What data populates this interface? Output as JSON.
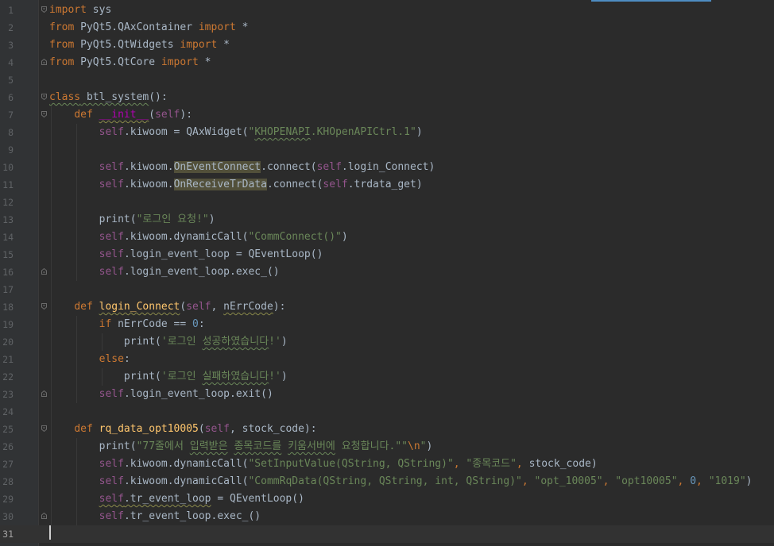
{
  "editor": {
    "language": "python",
    "current_line": 31,
    "lines": [
      {
        "n": "1",
        "fold": "top",
        "tokens": [
          [
            "kw",
            "import"
          ],
          [
            "p",
            " sys"
          ]
        ]
      },
      {
        "n": "2",
        "fold": "",
        "tokens": [
          [
            "kw",
            "from"
          ],
          [
            "p",
            " PyQt5.QAxContainer "
          ],
          [
            "kw",
            "import"
          ],
          [
            "p",
            " *"
          ]
        ]
      },
      {
        "n": "3",
        "fold": "",
        "tokens": [
          [
            "kw",
            "from"
          ],
          [
            "p",
            " PyQt5.QtWidgets "
          ],
          [
            "kw",
            "import"
          ],
          [
            "p",
            " *"
          ]
        ]
      },
      {
        "n": "4",
        "fold": "bottom",
        "tokens": [
          [
            "kw",
            "from"
          ],
          [
            "p",
            " PyQt5.QtCore "
          ],
          [
            "kw",
            "import"
          ],
          [
            "p",
            " *"
          ]
        ]
      },
      {
        "n": "5",
        "fold": "",
        "tokens": []
      },
      {
        "n": "6",
        "fold": "top",
        "tokens": [
          [
            "kw wavy",
            "class"
          ],
          [
            "p wavy",
            " btl_system"
          ],
          [
            "p",
            "():"
          ]
        ]
      },
      {
        "n": "7",
        "fold": "top",
        "tokens": [
          [
            "p",
            "    "
          ],
          [
            "kw",
            "def "
          ],
          [
            "magic wavy-y",
            "__init__"
          ],
          [
            "p",
            "("
          ],
          [
            "self",
            "self"
          ],
          [
            "p",
            "):"
          ]
        ]
      },
      {
        "n": "8",
        "fold": "",
        "tokens": [
          [
            "p",
            "        "
          ],
          [
            "self",
            "self"
          ],
          [
            "p",
            ".kiwoom = QAxWidget("
          ],
          [
            "str",
            "\""
          ],
          [
            "str wavy",
            "KHOPENAPI"
          ],
          [
            "str",
            ".KHOpenAPICtrl.1\""
          ],
          [
            "p",
            ")"
          ]
        ]
      },
      {
        "n": "9",
        "fold": "",
        "tokens": []
      },
      {
        "n": "10",
        "fold": "",
        "tokens": [
          [
            "p",
            "        "
          ],
          [
            "self",
            "self"
          ],
          [
            "p",
            ".kiwoom."
          ],
          [
            "p hl",
            "OnEventConnect"
          ],
          [
            "p",
            ".connect("
          ],
          [
            "self",
            "self"
          ],
          [
            "p",
            ".login_Connect)"
          ]
        ]
      },
      {
        "n": "11",
        "fold": "",
        "tokens": [
          [
            "p",
            "        "
          ],
          [
            "self",
            "self"
          ],
          [
            "p",
            ".kiwoom."
          ],
          [
            "p hl",
            "OnReceiveTrData"
          ],
          [
            "p",
            ".connect("
          ],
          [
            "self",
            "self"
          ],
          [
            "p",
            ".trdata_get)"
          ]
        ]
      },
      {
        "n": "12",
        "fold": "",
        "tokens": []
      },
      {
        "n": "13",
        "fold": "",
        "tokens": [
          [
            "p",
            "        print("
          ],
          [
            "str",
            "\"로그인 요청!\""
          ],
          [
            "p",
            ")"
          ]
        ]
      },
      {
        "n": "14",
        "fold": "",
        "tokens": [
          [
            "p",
            "        "
          ],
          [
            "self",
            "self"
          ],
          [
            "p",
            ".kiwoom.dynamicCall("
          ],
          [
            "str",
            "\"CommConnect()\""
          ],
          [
            "p",
            ")"
          ]
        ]
      },
      {
        "n": "15",
        "fold": "",
        "tokens": [
          [
            "p",
            "        "
          ],
          [
            "self",
            "self"
          ],
          [
            "p",
            ".login_event_loop = QEventLoop()"
          ]
        ]
      },
      {
        "n": "16",
        "fold": "bottom",
        "tokens": [
          [
            "p",
            "        "
          ],
          [
            "self",
            "self"
          ],
          [
            "p",
            ".login_event_loop.exec_()"
          ]
        ]
      },
      {
        "n": "17",
        "fold": "",
        "tokens": []
      },
      {
        "n": "18",
        "fold": "top",
        "tokens": [
          [
            "p",
            "    "
          ],
          [
            "kw",
            "def "
          ],
          [
            "fn wavy-y",
            "login_Connect"
          ],
          [
            "p",
            "("
          ],
          [
            "self",
            "self"
          ],
          [
            "p",
            ", "
          ],
          [
            "p wavy-y",
            "nErrCode"
          ],
          [
            "p",
            "):"
          ]
        ]
      },
      {
        "n": "19",
        "fold": "",
        "tokens": [
          [
            "p",
            "        "
          ],
          [
            "kw",
            "if"
          ],
          [
            "p",
            " nErrCode == "
          ],
          [
            "num",
            "0"
          ],
          [
            "p",
            ":"
          ]
        ]
      },
      {
        "n": "20",
        "fold": "",
        "tokens": [
          [
            "p",
            "            print("
          ],
          [
            "str",
            "'로그인 "
          ],
          [
            "str wavy",
            "성공하였습니다"
          ],
          [
            "str",
            "!'"
          ],
          [
            "p",
            ")"
          ]
        ]
      },
      {
        "n": "21",
        "fold": "",
        "tokens": [
          [
            "p",
            "        "
          ],
          [
            "kw",
            "else"
          ],
          [
            "p",
            ":"
          ]
        ]
      },
      {
        "n": "22",
        "fold": "",
        "tokens": [
          [
            "p",
            "            print("
          ],
          [
            "str",
            "'로그인 "
          ],
          [
            "str wavy",
            "실패하였습니다"
          ],
          [
            "str",
            "!'"
          ],
          [
            "p",
            ")"
          ]
        ]
      },
      {
        "n": "23",
        "fold": "bottom",
        "tokens": [
          [
            "p",
            "        "
          ],
          [
            "self",
            "self"
          ],
          [
            "p",
            ".login_event_loop.exit()"
          ]
        ]
      },
      {
        "n": "24",
        "fold": "",
        "tokens": []
      },
      {
        "n": "25",
        "fold": "top",
        "tokens": [
          [
            "p",
            "    "
          ],
          [
            "kw",
            "def "
          ],
          [
            "fn",
            "rq_data_opt10005"
          ],
          [
            "p",
            "("
          ],
          [
            "self",
            "self"
          ],
          [
            "p",
            ", stock_code):"
          ]
        ]
      },
      {
        "n": "26",
        "fold": "",
        "tokens": [
          [
            "p",
            "        print("
          ],
          [
            "str",
            "\"77줄에서 "
          ],
          [
            "str wavy",
            "입력받은"
          ],
          [
            "str",
            " "
          ],
          [
            "str wavy",
            "종목코드를"
          ],
          [
            "str",
            " "
          ],
          [
            "str wavy",
            "키움서버에"
          ],
          [
            "str",
            " 요청합니다.\"\""
          ],
          [
            "esc",
            "\\n"
          ],
          [
            "str",
            "\""
          ],
          [
            "p",
            ")"
          ]
        ]
      },
      {
        "n": "27",
        "fold": "",
        "tokens": [
          [
            "p",
            "        "
          ],
          [
            "self",
            "self"
          ],
          [
            "p",
            ".kiwoom.dynamicCall("
          ],
          [
            "str",
            "\"SetInputValue(QString, QString)\""
          ],
          [
            "kw",
            ", "
          ],
          [
            "str",
            "\"종목코드\""
          ],
          [
            "kw",
            ", "
          ],
          [
            "p",
            "stock_code)"
          ]
        ]
      },
      {
        "n": "28",
        "fold": "",
        "tokens": [
          [
            "p",
            "        "
          ],
          [
            "self",
            "self"
          ],
          [
            "p",
            ".kiwoom.dynamicCall("
          ],
          [
            "str",
            "\"CommRqData(QString, QString, int, QString)\""
          ],
          [
            "kw",
            ", "
          ],
          [
            "str",
            "\"opt_10005\""
          ],
          [
            "kw",
            ", "
          ],
          [
            "str",
            "\"opt10005\""
          ],
          [
            "kw",
            ", "
          ],
          [
            "num",
            "0"
          ],
          [
            "kw",
            ", "
          ],
          [
            "str",
            "\"1019\""
          ],
          [
            "p",
            ")"
          ]
        ]
      },
      {
        "n": "29",
        "fold": "",
        "tokens": [
          [
            "p",
            "        "
          ],
          [
            "self wavy-y",
            "self"
          ],
          [
            "p wavy-y",
            ".tr_event_loop"
          ],
          [
            "p",
            " = QEventLoop()"
          ]
        ]
      },
      {
        "n": "30",
        "fold": "bottom",
        "tokens": [
          [
            "p",
            "        "
          ],
          [
            "self",
            "self"
          ],
          [
            "p",
            ".tr_event_loop.exec_()"
          ]
        ]
      },
      {
        "n": "31",
        "fold": "",
        "tokens": []
      }
    ]
  }
}
